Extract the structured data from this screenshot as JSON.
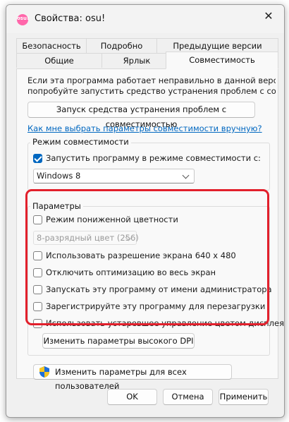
{
  "window": {
    "title": "Свойства: osu!",
    "app_icon": "osu-icon",
    "app_icon_text": "osu!",
    "close_glyph": "✕"
  },
  "tabs_row1": [
    {
      "label": "Безопасность"
    },
    {
      "label": "Подробно"
    },
    {
      "label": "Предыдущие версии"
    }
  ],
  "tabs_row2": [
    {
      "label": "Общие"
    },
    {
      "label": "Ярлык"
    },
    {
      "label": "Совместимость",
      "active": true
    }
  ],
  "intro": {
    "line1": "Если эта программа работает неправильно в данной версии Window",
    "line2": "попробуйте запустить средство устранения проблем с совместимо"
  },
  "troubleshoot_button": "Запуск средства устранения проблем с совместимостью",
  "manual_link": "Как мне выбрать параметры совместимости вручную?",
  "compat_mode": {
    "title": "Режим совместимости",
    "checkbox_label": "Запустить программу в режиме совместимости с:",
    "checked": true,
    "selected_os": "Windows 8"
  },
  "settings": {
    "title": "Параметры",
    "reduced_color": {
      "label": "Режим пониженной цветности",
      "checked": false
    },
    "color_select": "8-разрядный цвет (256)",
    "resolution": {
      "label": "Использовать разрешение экрана 640 x 480",
      "checked": false
    },
    "fullscreen_opt": {
      "label": "Отключить оптимизацию во весь экран",
      "checked": false
    },
    "run_admin": {
      "label": "Запускать эту программу от имени администратора",
      "checked": false
    },
    "register_restart": {
      "label": "Зарегистрируйте эту программу для перезагрузки",
      "checked": false
    },
    "legacy_icc": {
      "label": "Использовать устаревшее управление цветом дисплея ICC",
      "checked": false
    },
    "high_dpi_button": "Изменить параметры высокого DPI"
  },
  "all_users_button": "Изменить параметры для всех пользователей",
  "footer": {
    "ok": "OK",
    "cancel": "Отмена",
    "apply": "Применить"
  },
  "colors": {
    "accent": "#0067c0",
    "highlight": "#e2202c"
  }
}
